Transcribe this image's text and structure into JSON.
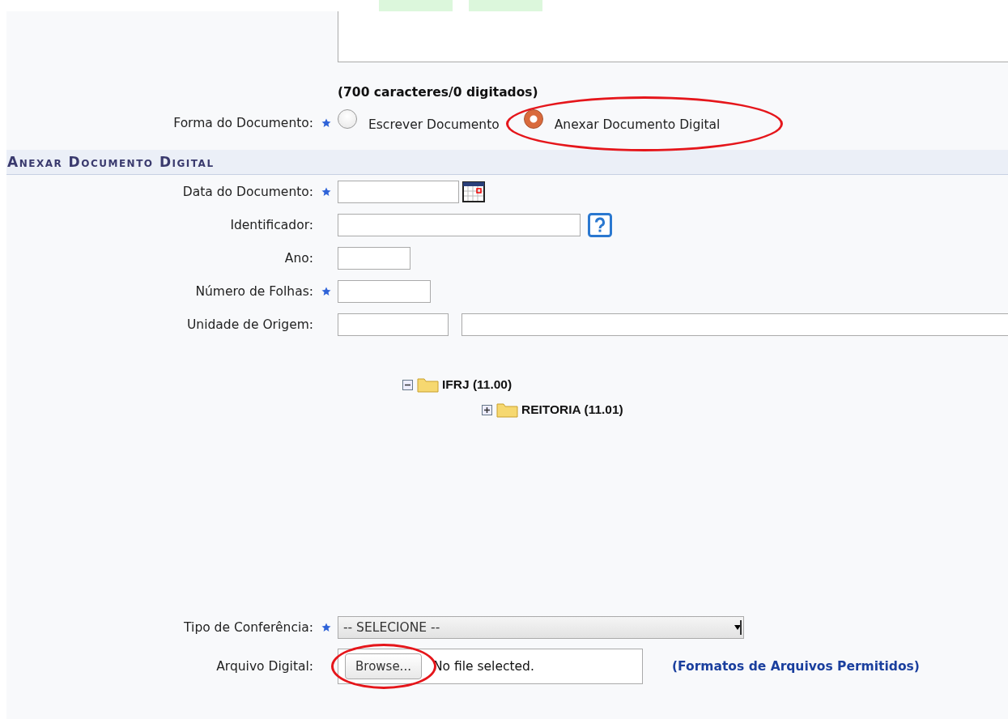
{
  "char_counter": "(700 caracteres/0 digitados)",
  "document_form": {
    "label": "Forma do Documento:",
    "required": true,
    "options": [
      {
        "label": "Escrever Documento",
        "selected": false
      },
      {
        "label": "Anexar Documento Digital",
        "selected": true,
        "highlighted": true
      }
    ]
  },
  "section_title": "Anexar Documento Digital",
  "fields": [
    {
      "label": "Data do Documento:",
      "required": true,
      "kind": "date"
    },
    {
      "label": "Identificador:",
      "required": false,
      "kind": "help"
    },
    {
      "label": "Ano:",
      "required": false,
      "kind": "short"
    },
    {
      "label": "Número de Folhas:",
      "required": true,
      "kind": "medium"
    },
    {
      "label": "Unidade de Origem:",
      "required": false,
      "kind": "pair"
    }
  ],
  "tree": [
    {
      "label": "IFRJ (11.00)",
      "expanded": true,
      "children": [
        {
          "label": "REITORIA (11.01)",
          "expanded": false
        }
      ]
    }
  ],
  "conference": {
    "label": "Tipo de Conferência:",
    "required": true,
    "value": "-- SELECIONE --"
  },
  "file": {
    "label": "Arquivo Digital:",
    "button": "Browse...",
    "button_highlighted": true,
    "status": "No file selected.",
    "link": "(Formatos de Arquivos Permitidos)"
  }
}
